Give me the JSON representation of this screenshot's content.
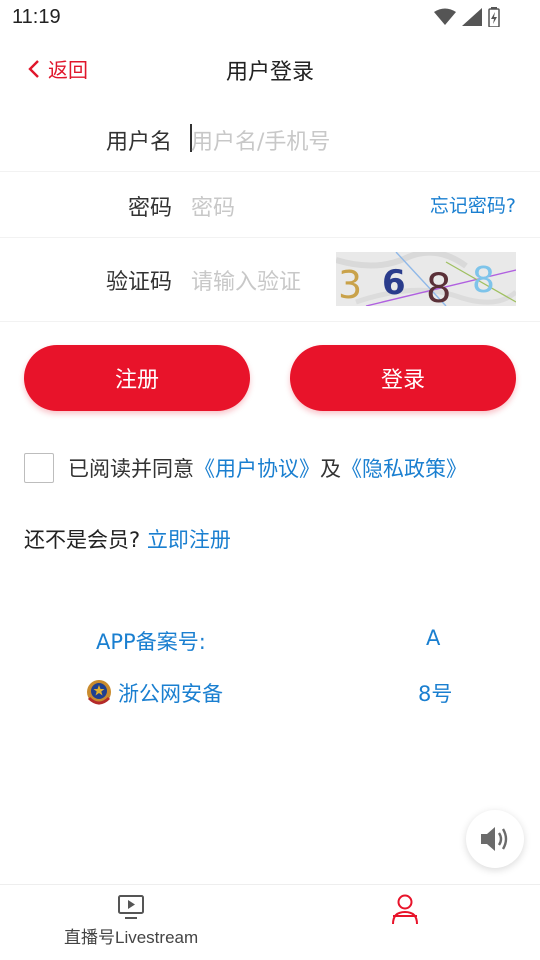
{
  "status_bar": {
    "time": "11:19"
  },
  "header": {
    "back_label": "返回",
    "title": "用户登录"
  },
  "form": {
    "username": {
      "label": "用户名",
      "placeholder": "用户名/手机号"
    },
    "password": {
      "label": "密码",
      "placeholder": "密码",
      "forgot_label": "忘记密码?"
    },
    "captcha": {
      "label": "验证码",
      "placeholder": "请输入验证",
      "digits": [
        "3",
        "6",
        "8",
        "8"
      ]
    }
  },
  "buttons": {
    "register": "注册",
    "login": "登录"
  },
  "agreement": {
    "prefix": "已阅读并同意",
    "user_agreement": "《用户协议》",
    "and": "及",
    "privacy_policy": "《隐私政策》"
  },
  "member": {
    "question": "还不是会员?",
    "register_now": "立即注册"
  },
  "footer": {
    "app_filing_label": "APP备案号:",
    "app_filing_value": "A",
    "police_label": "浙公网安备",
    "police_value": "8号"
  },
  "tab_bar": {
    "live_label": "直播号Livestream"
  },
  "colors": {
    "accent": "#e8132a",
    "link": "#1a7fd0"
  }
}
